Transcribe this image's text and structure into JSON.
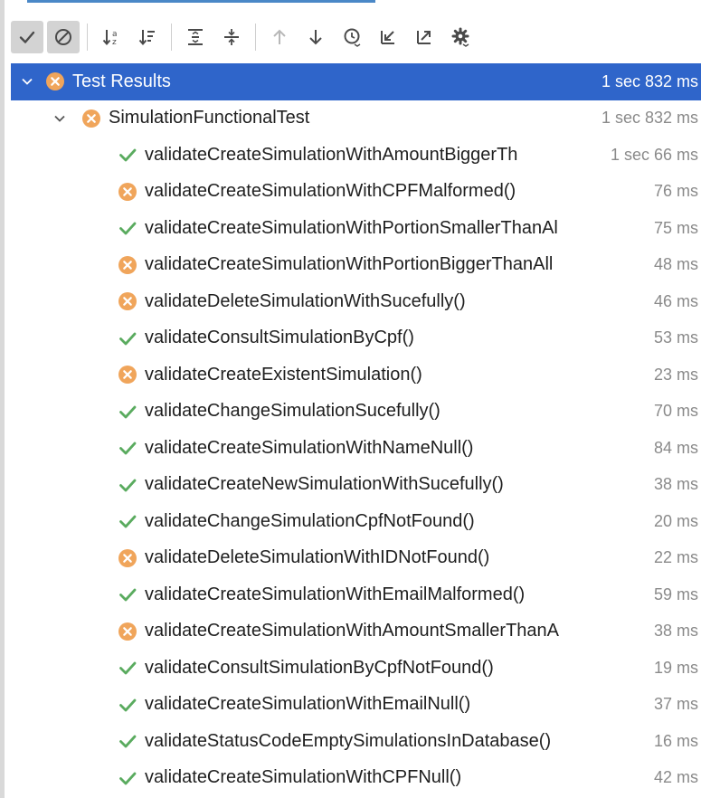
{
  "toolbar": {
    "buttons": [
      {
        "icon": "show-passed-icon",
        "toggled": true
      },
      {
        "icon": "show-ignored-icon",
        "toggled": true
      },
      {
        "icon": "sort-alphabetically-icon",
        "toggled": false
      },
      {
        "icon": "sort-by-duration-icon",
        "toggled": false
      },
      {
        "icon": "expand-all-icon",
        "toggled": false
      },
      {
        "icon": "collapse-all-icon",
        "toggled": false
      },
      {
        "icon": "previous-failed-icon",
        "toggled": false
      },
      {
        "icon": "next-failed-icon",
        "toggled": false
      },
      {
        "icon": "test-history-icon",
        "toggled": false
      },
      {
        "icon": "import-tests-icon",
        "toggled": false
      },
      {
        "icon": "export-tests-icon",
        "toggled": false
      },
      {
        "icon": "settings-icon",
        "toggled": false
      }
    ]
  },
  "colors": {
    "selection": "#2f65ca",
    "passed": "#5aab5f",
    "failed": "#f0a55b"
  },
  "root": {
    "label": "Test Results",
    "duration": "1 sec 832 ms",
    "status": "failed"
  },
  "suite": {
    "label": "SimulationFunctionalTest",
    "duration": "1 sec 832 ms",
    "status": "failed"
  },
  "tests": [
    {
      "label": "validateCreateSimulationWithAmountBiggerTh",
      "duration": "1 sec 66 ms",
      "status": "passed"
    },
    {
      "label": "validateCreateSimulationWithCPFMalformed()",
      "duration": "76 ms",
      "status": "failed"
    },
    {
      "label": "validateCreateSimulationWithPortionSmallerThanAl",
      "duration": "75 ms",
      "status": "passed"
    },
    {
      "label": "validateCreateSimulationWithPortionBiggerThanAll",
      "duration": "48 ms",
      "status": "failed"
    },
    {
      "label": "validateDeleteSimulationWithSucefully()",
      "duration": "46 ms",
      "status": "failed"
    },
    {
      "label": "validateConsultSimulationByCpf()",
      "duration": "53 ms",
      "status": "passed"
    },
    {
      "label": "validateCreateExistentSimulation()",
      "duration": "23 ms",
      "status": "failed"
    },
    {
      "label": "validateChangeSimulationSucefully()",
      "duration": "70 ms",
      "status": "passed"
    },
    {
      "label": "validateCreateSimulationWithNameNull()",
      "duration": "84 ms",
      "status": "passed"
    },
    {
      "label": "validateCreateNewSimulationWithSucefully()",
      "duration": "38 ms",
      "status": "passed"
    },
    {
      "label": "validateChangeSimulationCpfNotFound()",
      "duration": "20 ms",
      "status": "passed"
    },
    {
      "label": "validateDeleteSimulationWithIDNotFound()",
      "duration": "22 ms",
      "status": "failed"
    },
    {
      "label": "validateCreateSimulationWithEmailMalformed()",
      "duration": "59 ms",
      "status": "passed"
    },
    {
      "label": "validateCreateSimulationWithAmountSmallerThanA",
      "duration": "38 ms",
      "status": "failed"
    },
    {
      "label": "validateConsultSimulationByCpfNotFound()",
      "duration": "19 ms",
      "status": "passed"
    },
    {
      "label": "validateCreateSimulationWithEmailNull()",
      "duration": "37 ms",
      "status": "passed"
    },
    {
      "label": "validateStatusCodeEmptySimulationsInDatabase()",
      "duration": "16 ms",
      "status": "passed"
    },
    {
      "label": "validateCreateSimulationWithCPFNull()",
      "duration": "42 ms",
      "status": "passed"
    }
  ]
}
